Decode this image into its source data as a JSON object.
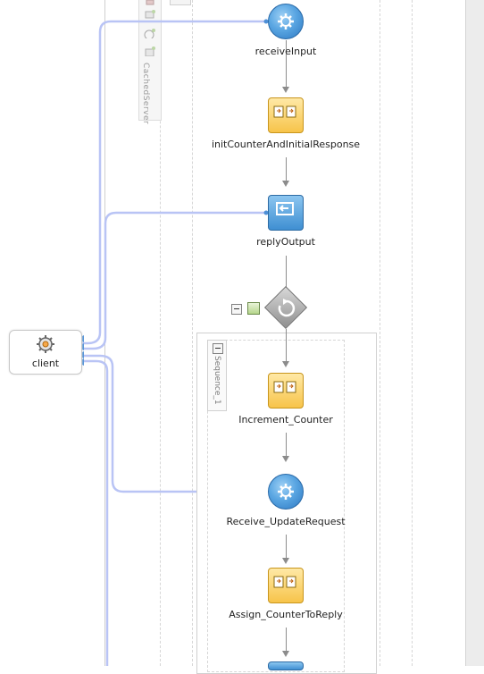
{
  "partner_tray": {
    "label": "CachedServer"
  },
  "client": {
    "label": "client",
    "icon": "gear-service-icon"
  },
  "activities": [
    {
      "id": "receiveInput",
      "label": "receiveInput",
      "kind": "receive",
      "icon": "gear-icon"
    },
    {
      "id": "initCounterAndInitialResponse",
      "label": "initCounterAndInitialResponse",
      "kind": "assign",
      "icon": "assign-icon"
    },
    {
      "id": "replyOutput",
      "label": "replyOutput",
      "kind": "reply",
      "icon": "reply-icon"
    },
    {
      "id": "Increment_Counter",
      "label": "Increment_Counter",
      "kind": "assign",
      "icon": "assign-icon"
    },
    {
      "id": "Receive_UpdateRequest",
      "label": "Receive_UpdateRequest",
      "kind": "receive",
      "icon": "gear-icon"
    },
    {
      "id": "Assign_CounterToReply",
      "label": "Assign_CounterToReply",
      "kind": "assign",
      "icon": "assign-icon"
    }
  ],
  "while_loop": {
    "icon": "loop-icon"
  },
  "sequence": {
    "label": "Sequence_1"
  },
  "colors": {
    "link": "#b9c4f5",
    "receive": "#5aa6e2",
    "assign": "#f7c44a",
    "connector": "#8c8c8c"
  }
}
